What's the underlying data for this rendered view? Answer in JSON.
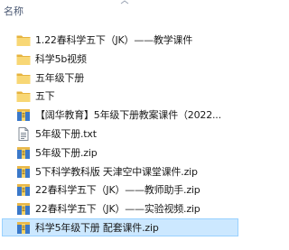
{
  "header": {
    "name_column": "名称"
  },
  "files": [
    {
      "name": "1.22春科学五下（JK）——教学课件",
      "type": "folder",
      "icon": "folder-icon"
    },
    {
      "name": "科学5b视频",
      "type": "folder",
      "icon": "folder-icon"
    },
    {
      "name": "五年级下册",
      "type": "folder",
      "icon": "folder-icon"
    },
    {
      "name": "五下",
      "type": "folder",
      "icon": "folder-icon"
    },
    {
      "name": "【阔华教育】5年级下册教案课件（2022...",
      "type": "zip",
      "icon": "zip-archive-icon"
    },
    {
      "name": "5年级下册.txt",
      "type": "txt",
      "icon": "text-file-icon"
    },
    {
      "name": "5年级下册.zip",
      "type": "zip",
      "icon": "zip-archive-icon"
    },
    {
      "name": "5下科学教科版 天津空中课堂课件.zip",
      "type": "zip",
      "icon": "zip-archive-icon"
    },
    {
      "name": "22春科学五下（JK）——教师助手.zip",
      "type": "zip",
      "icon": "zip-archive-icon"
    },
    {
      "name": "22春科学五下（JK）——实验视频.zip",
      "type": "zip",
      "icon": "zip-archive-icon"
    },
    {
      "name": "科学5年级下册 配套课件.zip",
      "type": "zip",
      "icon": "zip-archive-icon",
      "selected": true
    }
  ],
  "colors": {
    "header_text": "#4c5a74",
    "selection_bg": "#cce8ff",
    "selection_border": "#99d1ff",
    "folder": "#f8d775",
    "folder_dark": "#e6b33e"
  }
}
